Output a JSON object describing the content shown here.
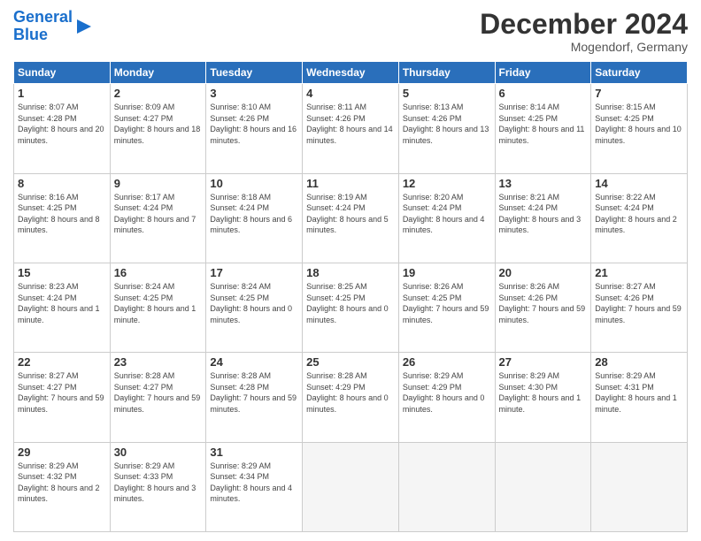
{
  "header": {
    "logo_line1": "General",
    "logo_line2": "Blue",
    "month": "December 2024",
    "location": "Mogendorf, Germany"
  },
  "weekdays": [
    "Sunday",
    "Monday",
    "Tuesday",
    "Wednesday",
    "Thursday",
    "Friday",
    "Saturday"
  ],
  "weeks": [
    [
      {
        "day": "1",
        "sunrise": "8:07 AM",
        "sunset": "4:28 PM",
        "daylight": "8 hours and 20 minutes."
      },
      {
        "day": "2",
        "sunrise": "8:09 AM",
        "sunset": "4:27 PM",
        "daylight": "8 hours and 18 minutes."
      },
      {
        "day": "3",
        "sunrise": "8:10 AM",
        "sunset": "4:26 PM",
        "daylight": "8 hours and 16 minutes."
      },
      {
        "day": "4",
        "sunrise": "8:11 AM",
        "sunset": "4:26 PM",
        "daylight": "8 hours and 14 minutes."
      },
      {
        "day": "5",
        "sunrise": "8:13 AM",
        "sunset": "4:26 PM",
        "daylight": "8 hours and 13 minutes."
      },
      {
        "day": "6",
        "sunrise": "8:14 AM",
        "sunset": "4:25 PM",
        "daylight": "8 hours and 11 minutes."
      },
      {
        "day": "7",
        "sunrise": "8:15 AM",
        "sunset": "4:25 PM",
        "daylight": "8 hours and 10 minutes."
      }
    ],
    [
      {
        "day": "8",
        "sunrise": "8:16 AM",
        "sunset": "4:25 PM",
        "daylight": "8 hours and 8 minutes."
      },
      {
        "day": "9",
        "sunrise": "8:17 AM",
        "sunset": "4:24 PM",
        "daylight": "8 hours and 7 minutes."
      },
      {
        "day": "10",
        "sunrise": "8:18 AM",
        "sunset": "4:24 PM",
        "daylight": "8 hours and 6 minutes."
      },
      {
        "day": "11",
        "sunrise": "8:19 AM",
        "sunset": "4:24 PM",
        "daylight": "8 hours and 5 minutes."
      },
      {
        "day": "12",
        "sunrise": "8:20 AM",
        "sunset": "4:24 PM",
        "daylight": "8 hours and 4 minutes."
      },
      {
        "day": "13",
        "sunrise": "8:21 AM",
        "sunset": "4:24 PM",
        "daylight": "8 hours and 3 minutes."
      },
      {
        "day": "14",
        "sunrise": "8:22 AM",
        "sunset": "4:24 PM",
        "daylight": "8 hours and 2 minutes."
      }
    ],
    [
      {
        "day": "15",
        "sunrise": "8:23 AM",
        "sunset": "4:24 PM",
        "daylight": "8 hours and 1 minute."
      },
      {
        "day": "16",
        "sunrise": "8:24 AM",
        "sunset": "4:25 PM",
        "daylight": "8 hours and 1 minute."
      },
      {
        "day": "17",
        "sunrise": "8:24 AM",
        "sunset": "4:25 PM",
        "daylight": "8 hours and 0 minutes."
      },
      {
        "day": "18",
        "sunrise": "8:25 AM",
        "sunset": "4:25 PM",
        "daylight": "8 hours and 0 minutes."
      },
      {
        "day": "19",
        "sunrise": "8:26 AM",
        "sunset": "4:25 PM",
        "daylight": "7 hours and 59 minutes."
      },
      {
        "day": "20",
        "sunrise": "8:26 AM",
        "sunset": "4:26 PM",
        "daylight": "7 hours and 59 minutes."
      },
      {
        "day": "21",
        "sunrise": "8:27 AM",
        "sunset": "4:26 PM",
        "daylight": "7 hours and 59 minutes."
      }
    ],
    [
      {
        "day": "22",
        "sunrise": "8:27 AM",
        "sunset": "4:27 PM",
        "daylight": "7 hours and 59 minutes."
      },
      {
        "day": "23",
        "sunrise": "8:28 AM",
        "sunset": "4:27 PM",
        "daylight": "7 hours and 59 minutes."
      },
      {
        "day": "24",
        "sunrise": "8:28 AM",
        "sunset": "4:28 PM",
        "daylight": "7 hours and 59 minutes."
      },
      {
        "day": "25",
        "sunrise": "8:28 AM",
        "sunset": "4:29 PM",
        "daylight": "8 hours and 0 minutes."
      },
      {
        "day": "26",
        "sunrise": "8:29 AM",
        "sunset": "4:29 PM",
        "daylight": "8 hours and 0 minutes."
      },
      {
        "day": "27",
        "sunrise": "8:29 AM",
        "sunset": "4:30 PM",
        "daylight": "8 hours and 1 minute."
      },
      {
        "day": "28",
        "sunrise": "8:29 AM",
        "sunset": "4:31 PM",
        "daylight": "8 hours and 1 minute."
      }
    ],
    [
      {
        "day": "29",
        "sunrise": "8:29 AM",
        "sunset": "4:32 PM",
        "daylight": "8 hours and 2 minutes."
      },
      {
        "day": "30",
        "sunrise": "8:29 AM",
        "sunset": "4:33 PM",
        "daylight": "8 hours and 3 minutes."
      },
      {
        "day": "31",
        "sunrise": "8:29 AM",
        "sunset": "4:34 PM",
        "daylight": "8 hours and 4 minutes."
      },
      null,
      null,
      null,
      null
    ]
  ]
}
